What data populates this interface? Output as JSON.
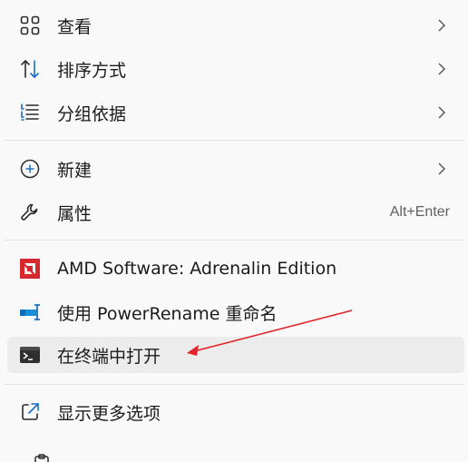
{
  "menu": {
    "items": [
      {
        "label": "查看",
        "icon": "view-grid-icon",
        "submenu": true
      },
      {
        "label": "排序方式",
        "icon": "sort-icon",
        "submenu": true
      },
      {
        "label": "分组依据",
        "icon": "group-list-icon",
        "submenu": true
      },
      {
        "label": "新建",
        "icon": "new-plus-icon",
        "submenu": true
      },
      {
        "label": "属性",
        "icon": "wrench-icon",
        "shortcut": "Alt+Enter"
      },
      {
        "label": "AMD Software: Adrenalin Edition",
        "icon": "amd-logo-icon"
      },
      {
        "label": "使用 PowerRename 重命名",
        "icon": "powerrename-icon"
      },
      {
        "label": "在终端中打开",
        "icon": "terminal-icon"
      },
      {
        "label": "显示更多选项",
        "icon": "share-open-icon"
      }
    ]
  },
  "colors": {
    "accent_blue": "#1a6fc4",
    "amd_red": "#d7282f",
    "annotation_arrow": "#e3242b"
  }
}
